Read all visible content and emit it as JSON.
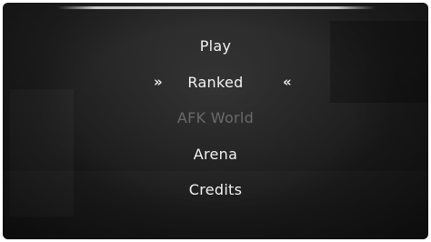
{
  "menu": {
    "items": [
      {
        "id": "play",
        "label": "Play",
        "enabled": true
      },
      {
        "id": "ranked",
        "label": "Ranked",
        "enabled": true,
        "selected": true
      },
      {
        "id": "afk-world",
        "label": "AFK World",
        "enabled": false
      },
      {
        "id": "arena",
        "label": "Arena",
        "enabled": true
      },
      {
        "id": "credits",
        "label": "Credits",
        "enabled": true
      }
    ],
    "selection_left_marker": "»",
    "selection_right_marker": "«"
  },
  "colors": {
    "text_enabled": "#f2f2f2",
    "text_disabled": "#6a6a6a",
    "background": "#1c1c1c"
  }
}
